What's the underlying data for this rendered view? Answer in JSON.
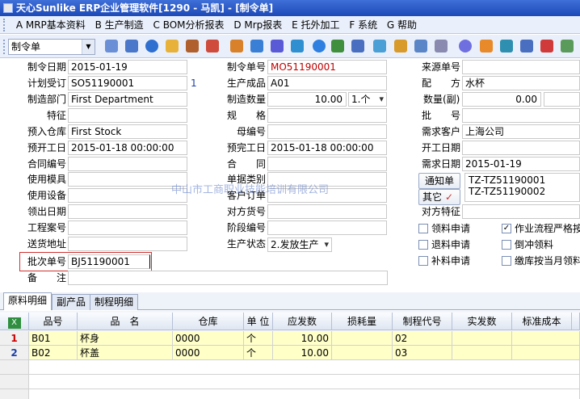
{
  "window": {
    "title": "天心Sunlike ERP企业管理软件[1290 - 马凯] - [制令单]"
  },
  "menu": [
    "A MRP基本资料",
    "B 生产制造",
    "C BOM分析报表",
    "D Mrp报表",
    "E 托外加工",
    "F 系统",
    "G 帮助"
  ],
  "toolbar": {
    "combo_value": "制令单"
  },
  "labels": {
    "mo_date": "制令日期",
    "plan_order": "计划受订",
    "dept": "制造部门",
    "feature": "特征",
    "warehouse": "预入仓库",
    "start_date": "预开工日",
    "contract_no": "合同编号",
    "mold": "使用模具",
    "equipment": "使用设备",
    "issue_date": "领出日期",
    "project": "工程案号",
    "address": "送货地址",
    "batch": "批次单号",
    "remark": "备　　注",
    "mo_no": "制令单号",
    "product": "生产成品",
    "qty": "制造数量",
    "spec": "规　　格",
    "parent": "母编号",
    "finish_date": "预完工日",
    "contract": "合　　同",
    "doc_type": "单据类别",
    "cust_order": "客户订单",
    "item_no": "对方货号",
    "stage": "阶段编号",
    "status": "生产状态",
    "source_no": "来源单号",
    "match": "配　　方",
    "aux_qty": "数量(副)",
    "batch_no": "批　　号",
    "customer": "需求客户",
    "actual_start": "开工日期",
    "need_date": "需求日期",
    "notify": "通知单",
    "other": "其它",
    "peer_feature": "对方特征"
  },
  "values": {
    "mo_date": "2015-01-19",
    "plan_order": "SO51190001",
    "plan_order_no": "1",
    "dept": "First Department",
    "warehouse": "First Stock",
    "start_date": "2015-01-18 00:00:00",
    "batch": "BJ51190001",
    "mo_no": "MO51190001",
    "product": "A01",
    "qty": "10.00",
    "unit": "1.个",
    "finish_date": "2015-01-18 00:00:00",
    "status": "2.发放生产",
    "match": "水杯",
    "aux_qty": "0.00",
    "customer": "上海公司",
    "need_date": "2015-01-19",
    "notify_list": [
      "TZ-TZ51190001",
      "TZ-TZ51190002"
    ]
  },
  "checks": [
    {
      "label": "领料申请",
      "checked": false
    },
    {
      "label": "退料申请",
      "checked": false
    },
    {
      "label": "补料申请",
      "checked": false
    },
    {
      "label": "作业流程严格按",
      "checked": true
    },
    {
      "label": "倒冲领料",
      "checked": false
    },
    {
      "label": "缴库按当月领料",
      "checked": false
    }
  ],
  "tabs": [
    "原料明细",
    "副产品",
    "制程明细"
  ],
  "grid": {
    "headers": [
      "品号",
      "品　名",
      "仓库",
      "单 位",
      "应发数",
      "损耗量",
      "制程代号",
      "实发数",
      "标准成本"
    ],
    "rows": [
      {
        "idx": "1",
        "code": "B01",
        "name": "杯身",
        "wh": "0000",
        "unit": "个",
        "qty": "10.00",
        "loss": "",
        "proc": "02",
        "actual": "",
        "cost": ""
      },
      {
        "idx": "2",
        "code": "B02",
        "name": "杯盖",
        "wh": "0000",
        "unit": "个",
        "qty": "10.00",
        "loss": "",
        "proc": "03",
        "actual": "",
        "cost": ""
      }
    ]
  },
  "watermark": "中山市工商职业技能培训有限公司"
}
